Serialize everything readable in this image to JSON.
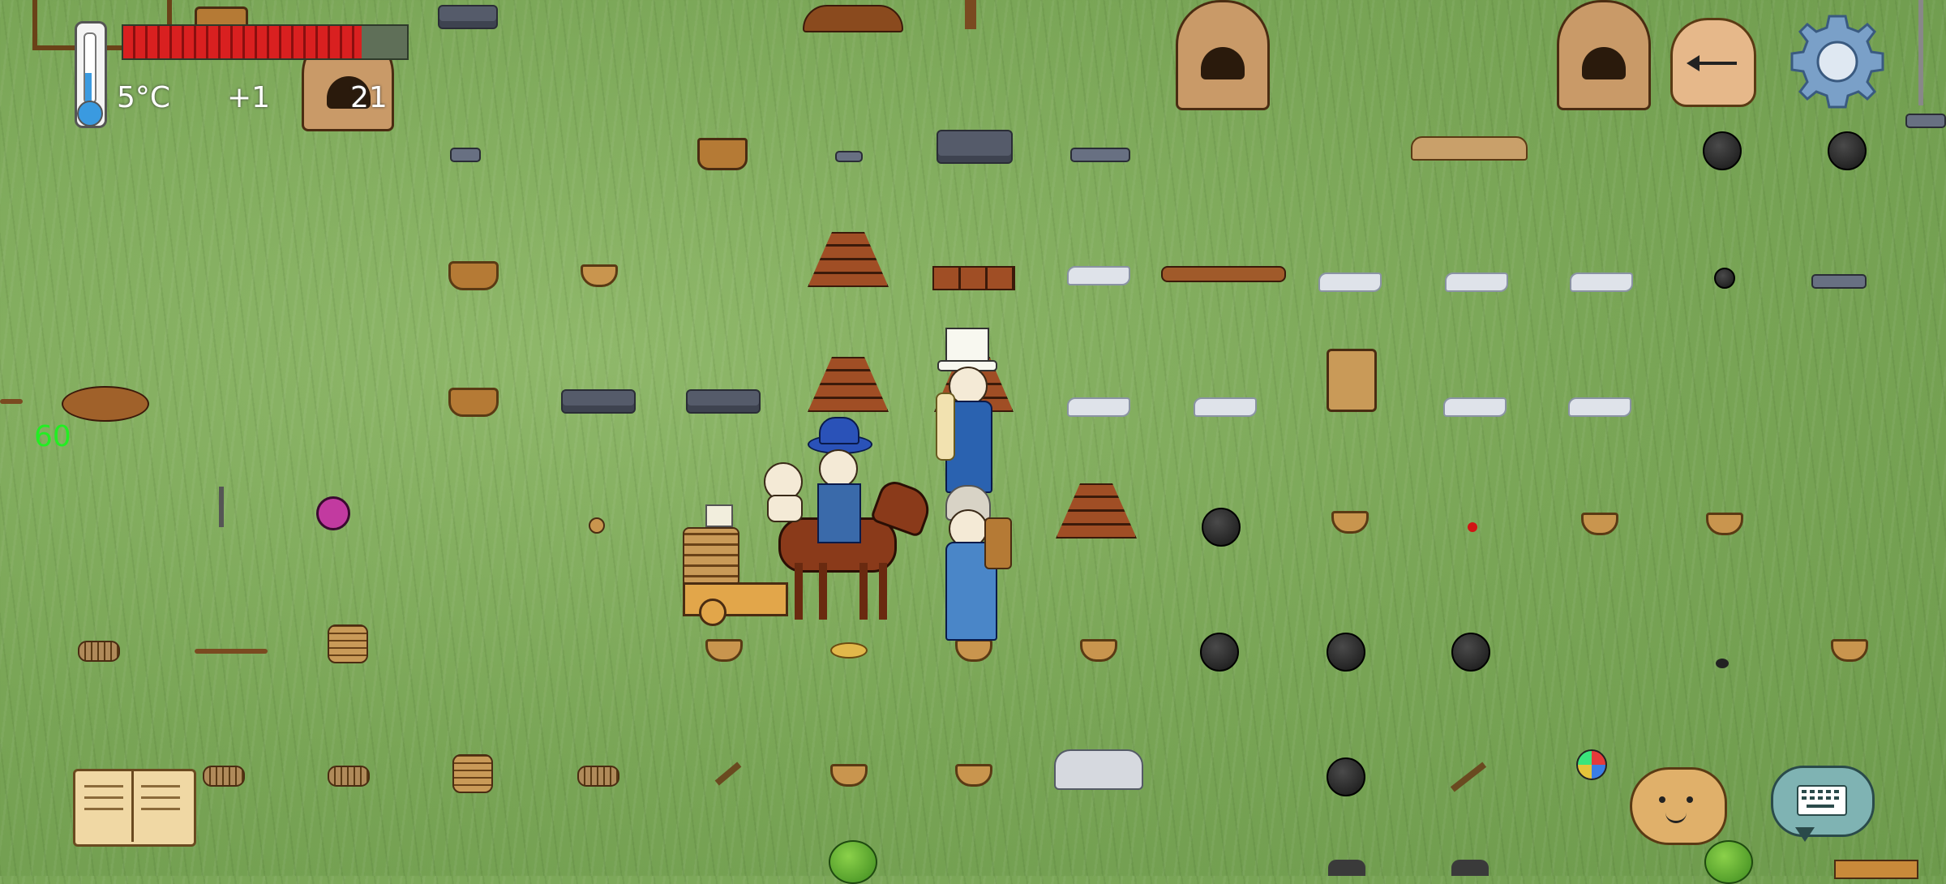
{
  "hud": {
    "temperature": "5°C",
    "food_bonus": "+1",
    "age": "21",
    "fps": "60",
    "food_level": 0.84,
    "temperature_icon": "thermometer-icon",
    "hunger_icon": "food-bar"
  },
  "controls": {
    "settings_icon": "gear-icon",
    "clock_icon": "sundial-icon",
    "book_icon": "tech-tree-book-icon",
    "keyboard_icon": "keyboard-chat-icon",
    "emote_icon": "potato-face-emote-icon"
  },
  "colors": {
    "grass": "#79a556",
    "food_bar_red": "#d92020",
    "fps_green": "#22ee22",
    "keyboard_button": "#7fb3b3"
  }
}
